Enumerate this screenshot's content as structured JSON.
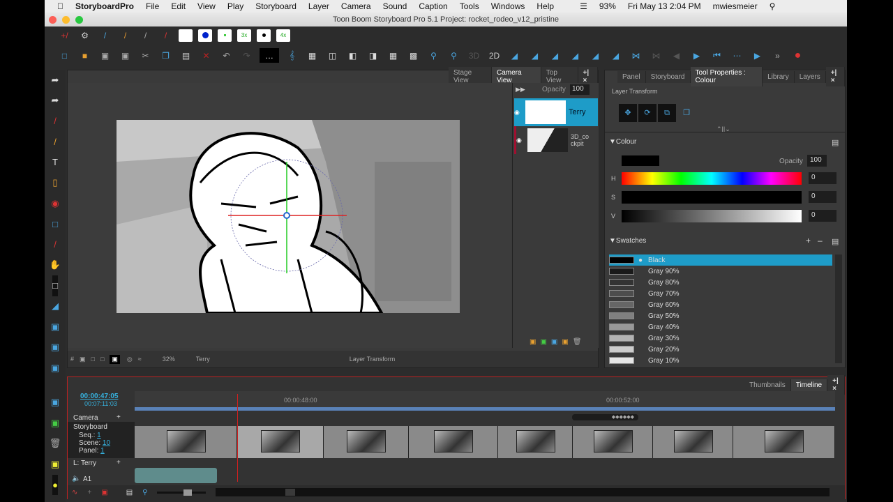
{
  "menubar": {
    "apple": "",
    "app": "StoryboardPro",
    "items": [
      "File",
      "Edit",
      "View",
      "Play",
      "Storyboard",
      "Layer",
      "Camera",
      "Sound",
      "Caption",
      "Tools",
      "Windows",
      "Help"
    ],
    "battery": "93%",
    "datetime": "Fri May 13  2:04 PM",
    "user": "mwiesmeier"
  },
  "window": {
    "title": "Toon Boom Storyboard Pro 5.1 Project: rocket_rodeo_v12_pristine"
  },
  "toolbar": {
    "swatch_labels": [
      "",
      "",
      "",
      "3x",
      "",
      "4x"
    ],
    "zoom_3d": "3D",
    "zoom_2d": "2D"
  },
  "camera_panel": {
    "tabs": [
      "Stage View",
      "Camera View",
      "Top View"
    ],
    "active_tab": "Camera View",
    "opacity_label": "Opacity",
    "opacity_value": "100",
    "layers": [
      {
        "name": "Terry",
        "selected": true
      },
      {
        "name": "3D_cockpit",
        "selected": false
      }
    ],
    "status": {
      "zoom": "32%",
      "layer": "Terry",
      "mode": "Layer Transform"
    }
  },
  "props_panel": {
    "tabs": [
      "Panel",
      "Storyboard",
      "Tool Properties : Colour",
      "Library",
      "Layers"
    ],
    "active_tab": "Tool Properties : Colour",
    "layer_transform_label": "Layer Transform",
    "colour_label": "Colour",
    "opacity_label": "Opacity",
    "opacity_value": "100",
    "h_label": "H",
    "h_value": "0",
    "s_label": "S",
    "s_value": "0",
    "v_label": "V",
    "v_value": "0",
    "swatches_label": "Swatches",
    "swatches": [
      {
        "name": "Black",
        "color": "#000000",
        "selected": true
      },
      {
        "name": "Gray 90%",
        "color": "#1a1a1a"
      },
      {
        "name": "Gray 80%",
        "color": "#333333"
      },
      {
        "name": "Gray 70%",
        "color": "#4d4d4d"
      },
      {
        "name": "Gray 60%",
        "color": "#666666"
      },
      {
        "name": "Gray 50%",
        "color": "#808080"
      },
      {
        "name": "Gray 40%",
        "color": "#999999"
      },
      {
        "name": "Gray 30%",
        "color": "#b3b3b3"
      },
      {
        "name": "Gray 20%",
        "color": "#cccccc"
      },
      {
        "name": "Gray 10%",
        "color": "#e6e6e6"
      }
    ]
  },
  "timeline": {
    "tabs": [
      "Thumbnails",
      "Timeline"
    ],
    "active_tab": "Timeline",
    "current_time": "00:00:47:05",
    "total_time": "00:07:11:03",
    "ruler_labels": [
      "00:00:48:00",
      "00:00:52:00"
    ],
    "tracks": {
      "camera": "Camera",
      "storyboard": "Storyboard",
      "seq_label": "Seq.:",
      "seq": "1",
      "scene_label": "Scene:",
      "scene": "10",
      "panel_label": "Panel:",
      "panel": "1",
      "layer": "L: Terry",
      "audio": "A1"
    }
  },
  "colors": {
    "accent": "#2a9fc9",
    "selection": "#1e9cc8",
    "playhead": "#d02020"
  }
}
